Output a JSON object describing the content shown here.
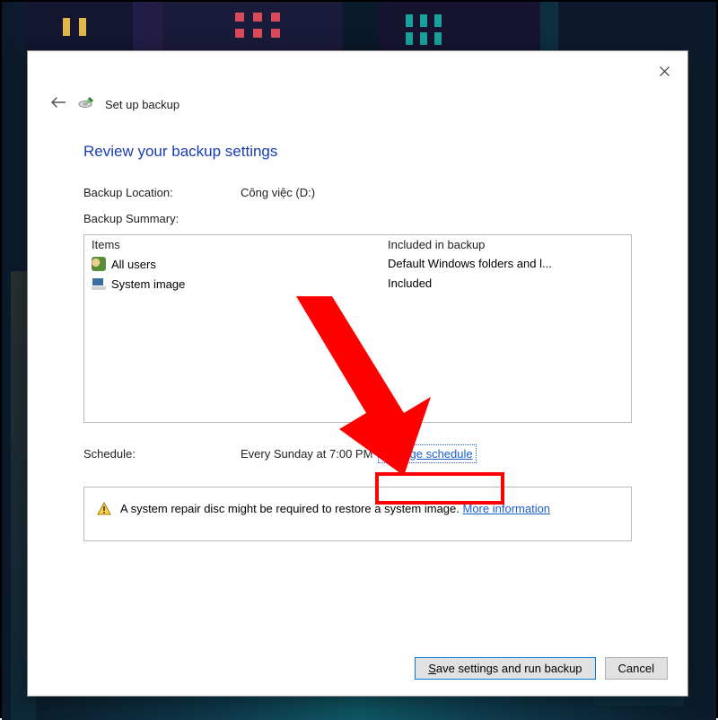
{
  "wizard": {
    "header": "Set up backup",
    "title": "Review your backup settings",
    "close_tooltip": "Close"
  },
  "location": {
    "label": "Backup Location:",
    "value": "Công việc (D:)"
  },
  "summary": {
    "label": "Backup Summary:",
    "col_items": "Items",
    "col_included": "Included in backup",
    "rows": [
      {
        "icon": "users-icon",
        "item": "All users",
        "included": "Default Windows folders and l..."
      },
      {
        "icon": "sysimg-icon",
        "item": "System image",
        "included": "Included"
      }
    ]
  },
  "schedule": {
    "label": "Schedule:",
    "value": "Every Sunday at 7:00 PM",
    "change_link": "Change schedule"
  },
  "info": {
    "text": "A system repair disc might be required to restore a system image. ",
    "link": "More information"
  },
  "buttons": {
    "save": "Save settings and run backup",
    "save_accel": "S",
    "cancel": "Cancel"
  }
}
